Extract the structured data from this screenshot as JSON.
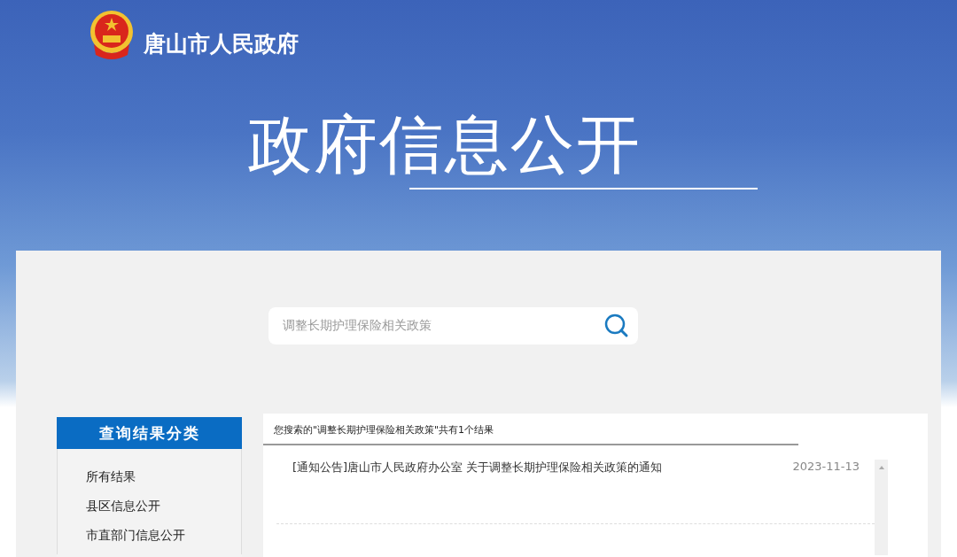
{
  "site": {
    "name": "唐山市人民政府"
  },
  "banner": {
    "title": "政府信息公开"
  },
  "search": {
    "value": "调整长期护理保险相关政策"
  },
  "sidebar": {
    "title": "查询结果分类",
    "items": [
      {
        "label": "所有结果"
      },
      {
        "label": "县区信息公开"
      },
      {
        "label": "市直部门信息公开"
      }
    ]
  },
  "results": {
    "summary": "您搜索的\"调整长期护理保险相关政策\"共有1个结果",
    "rows": [
      {
        "title": "[通知公告]唐山市人民政府办公室 关于调整长期护理保险相关政策的通知",
        "date": "2023-11-13"
      }
    ]
  }
}
